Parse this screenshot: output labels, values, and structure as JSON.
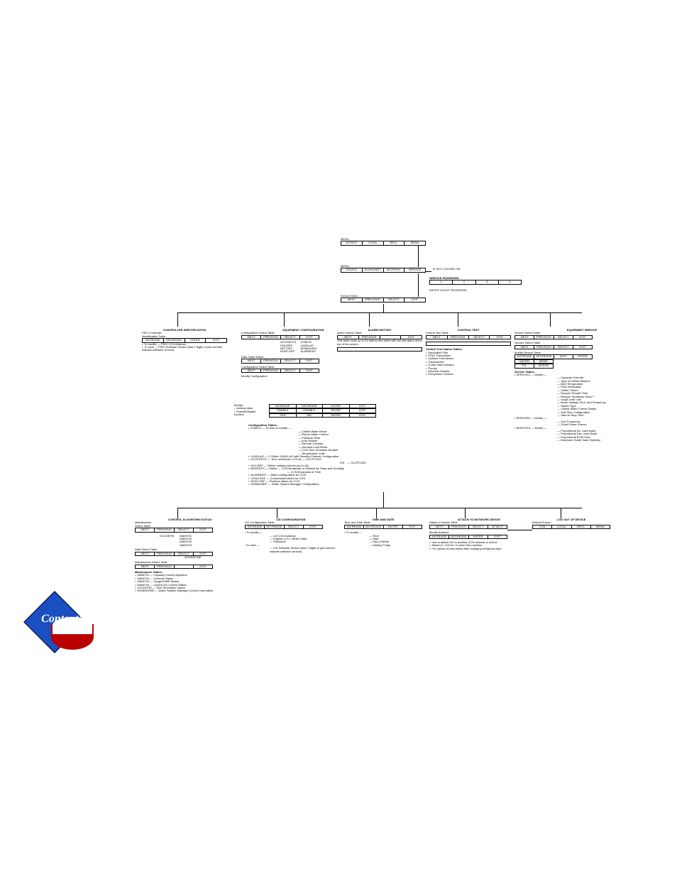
{
  "menu_top": {
    "label": "MENU",
    "buttons": [
      "ATTACH",
      "LOCAL",
      "RECL",
      "MENU"
    ]
  },
  "menu_mid": {
    "label": "MENU",
    "buttons": [
      "STATUS",
      "SCHED/SET",
      "SETPOINT",
      "SERVICE"
    ]
  },
  "not_logged": "IF NOT LOGGED ON",
  "service_pw": {
    "label": "SERVICE PASSWORD",
    "buttons": [
      "1",
      "2",
      "3",
      "4"
    ]
  },
  "enter_pw": "ENTER 4-DIGIT PASSWORD",
  "service_menu": {
    "label": "Service Menu",
    "buttons": [
      "NEXT",
      "PREVIOUS",
      "SELECT",
      "EXIT"
    ]
  },
  "ctrl_id": {
    "title": "CONTROLLER IDENTIFICATION",
    "sub": "PSIO Controller\nIdentification Table",
    "buttons": [
      "INCREASE",
      "DECREASE",
      "ENTER",
      "EXIT"
    ],
    "notes": [
      "To modify — PSIO CCN Address",
      "To view — PSIO Software Version (last 2 digits of part number indicate software version)"
    ]
  },
  "equip_cfg": {
    "title": "EQUIPMENT CONFIGURATION",
    "cfg_sel": "Configuration Select Table",
    "cfg_buttons": [
      "NEXT",
      "PREVIOUS",
      "SELECT",
      "EXIT"
    ],
    "col1": [
      "OCCDEFCS",
      "HOLIDEF",
      "NET-DEF",
      "RUNT-DEF"
    ],
    "col2": [
      "CONFIG",
      "LEADLAG",
      "WSMALMDF",
      "ALARMDEF"
    ],
    "data_sel": "Data Table Select",
    "data_buttons": [
      "NEXT",
      "PREVIOUS",
      "SELECT",
      "EXIT"
    ],
    "cfg_sel2": "Configuration Select Table",
    "cfg_sel2_buttons": [
      "NEXT",
      "PREVIOUS",
      "SELECT",
      "EXIT"
    ],
    "mod_cfg": "Modify Configuration",
    "modify_label": "Modify:",
    "modify_notes": [
      "Analog value",
      "Enable/Disable function"
    ],
    "mod_row1": [
      "INCREASE",
      "DECREASE",
      "ENTER",
      "EXIT"
    ],
    "mod_row2": [
      "ENABLE",
      "DISABLE",
      "ENTER",
      "EXIT"
    ],
    "mod_row3": [
      "YES",
      "NO",
      "ENTER",
      "EXIT"
    ],
    "cfg_tables": "Configuration Tables:",
    "config_head": "CONFIG — To view or modify —",
    "config_items": [
      "Chilled Water Reset",
      "Return Water Control",
      "Pulldown Rate",
      "Auto Restart",
      "Remote Controls",
      "Demand Limit Reset",
      "CCN Time Schedule Number",
      "Temperature Units"
    ],
    "others": [
      "LEADLAG — 2 Chiller LEAD/LAG with Standby Feature Configuration",
      "OCCDEFCS — Time schedules: LOCAL — OCCPC01S",
      "                                   ICE   — OCCPC02S",
      "HOLIDEF — Define holiday periods (up to 18)",
      "BRODEFS — Define — CCN Broadcast of Outside Air Temp and Humidity",
      "                         — CCN Broadcast of Time",
      "ALARMDEF — Alarm configuration for CCN",
      "CONS-DEF — Consumable tables for CCN",
      "RUNT-DEF — Runtime tables for CCN",
      "WSMALMDF — Water System Manager Configuration"
    ]
  },
  "alarm": {
    "title": "ALARM HISTORY",
    "sub": "Alarm History Table",
    "buttons": [
      "NEXT",
      "PREVIOUS",
      "",
      "EXIT"
    ],
    "note": "This table holds up to 25 alarms and alerts with the last alarm at the top of the screen"
  },
  "ctrl_test": {
    "title": "CONTROL TEST",
    "sub": "Control Test Table",
    "buttons": [
      "NEXT",
      "PREVIOUS",
      "SELECT",
      "EXIT"
    ],
    "options": "Control Test Option Tables:",
    "option_items": [
      "Automated Test",
      "PSIO Thermistors",
      "Options Thermistors",
      "Transducers",
      "Guide Vane Actuator",
      "Pumps",
      "Discrete Outputs",
      "Pumpdown Lockout"
    ]
  },
  "equip_svc": {
    "title": "EQUIPMENT SERVICE",
    "svc_sel": "Service Select Table",
    "svc_buttons": [
      "NEXT",
      "PREVIOUS",
      "SELECT",
      "EXIT"
    ],
    "svc_sel2": "Service Select Table",
    "svc_buttons2": [
      "NEXT",
      "PREVIOUS",
      "SELECT",
      "EXIT"
    ],
    "mod": "Modify Service Table",
    "mod_buttons": [
      "INCREASE",
      "DECREASE",
      "QUIT",
      "ENTER"
    ],
    "mod_row2": [
      "WATER",
      "BRINE"
    ],
    "mod_row3": [
      "P.d.",
      "NODGE"
    ],
    "tables": "Service Tables:",
    "s1_head": "SERVICE1 — Modify —",
    "s1_items": [
      "Capacity Override",
      "Type of Chilled Medium",
      "Alert Temperature",
      "Flow Verification",
      "Chiller Timers",
      "Recycle Restart Time",
      "Recycle Shutdown Delta T",
      "Surge Limit Line",
      "Motor Voltage, RLA, and Frequency",
      "Starter Type",
      "Chilled Water Freeze Safety",
      "Soft Stop Configuration",
      "Start-to-Stop Time"
    ],
    "s2_head": "SERVICE2 — Modify —",
    "s2_items": [
      "Line Frequency",
      "20mA Power Source"
    ],
    "s3_head": "SERVICE3 — Modify —",
    "s3_items": [
      "Proportional Inc. each Band",
      "Proportional Dec. each Band",
      "Proportional ECW Gain",
      "Maximum Guide Vane Opening"
    ]
  },
  "ctrl_alg": {
    "title": "CONTROL ALGORITHM STATUS",
    "maint": "Maintenance\nSelect Table",
    "buttons": [
      "NEXT",
      "PREVIOUS",
      "SELECT",
      "EXIT"
    ],
    "occ": "OCCDEFM",
    "occ_items": [
      "MAINT01",
      "MAINT02",
      "MAINT03",
      "MAINT04"
    ],
    "data_sel": "Data Select Table",
    "data_buttons": [
      "NEXT",
      "PREVIOUS",
      "SELECT",
      "EXIT"
    ],
    "maint_sel": "Maintenance Select Table",
    "maint_buttons": [
      "NEXT",
      "PREVIOUS",
      "",
      "EXIT"
    ],
    "mtables": "Maintenance Tables:",
    "mt_items": [
      "MAINT01 — Capacity Control Algorithm",
      "MAINT02 — Override Status",
      "MAINT03 — Surge/HGBP Status",
      "MAINT04 — LEAD/LAG Control Status",
      "OCCDEFM — Time Schedules Status",
      "WSMDEFME — Water System Manager Control Information"
    ],
    "wsm": "WSMDEFME"
  },
  "lid_cfg": {
    "title": "LID CONFIGURATION",
    "sub": "LID Configuration Table",
    "buttons": [
      "INCREASE",
      "DECREASE",
      "SELECT",
      "EXIT"
    ],
    "mod": "To modify —",
    "mod_items": [
      "LID CCN Address",
      "English or S.I. Metric Units",
      "Password"
    ],
    "view": "To view —",
    "view_items": [
      "LID Software Version (last 2 digits of part number indicate software version)"
    ]
  },
  "time_date": {
    "title": "TIME AND DATE",
    "sub": "Time and Date Table",
    "buttons": [
      "INCREASE",
      "DECREASE",
      "ENTER",
      "EXIT"
    ],
    "mod": "To modify —",
    "items": [
      "Time",
      "Date",
      "Day of Week",
      "Holiday Today"
    ]
  },
  "attach": {
    "title": "ATTACH TO NETWORK DEVICE",
    "sub": "Attach to Device Table",
    "buttons": [
      "NEXT",
      "PREVIOUS",
      "SELECT",
      "ATTACH"
    ],
    "mod": "Modify Address",
    "mod_buttons": [
      "INCREASE",
      "DECREASE",
      "ENTER",
      "EXIT"
    ],
    "notes": [
      "Use to attach LID to another CCN network or device",
      "Attach to \"LOCAL\" to enter this machine",
      "For upload of new tables after changing refrigerant type"
    ]
  },
  "logout": {
    "title": "LOG OUT OF DEVICE",
    "sub": "Default Screen",
    "buttons": [
      "CCN",
      "LOCAL",
      "RECL",
      "MENU"
    ]
  },
  "contents_label": "Contents"
}
